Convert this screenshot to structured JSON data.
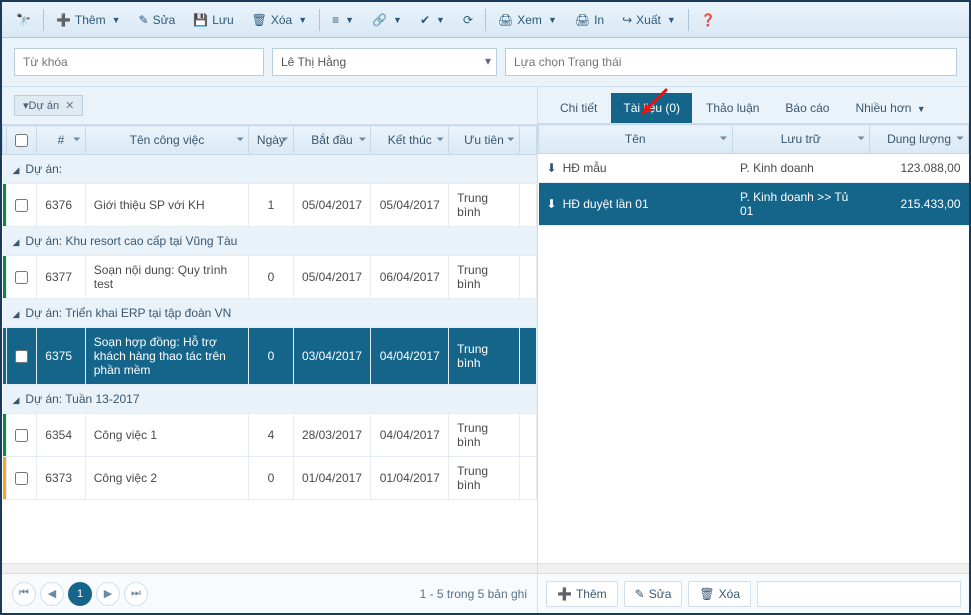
{
  "toolbar": {
    "add": "Thêm",
    "edit": "Sửa",
    "save": "Lưu",
    "delete": "Xóa",
    "view": "Xem",
    "print": "In",
    "export": "Xuất"
  },
  "filters": {
    "keyword_placeholder": "Từ khóa",
    "user_value": "Lê Thị Hằng",
    "status_placeholder": "Lựa chọn Trạng thái",
    "tag_label": "Dự án"
  },
  "grid": {
    "columns": {
      "id": "#",
      "name": "Tên công việc",
      "days": "Ngày",
      "start": "Bắt đầu",
      "end": "Kết thúc",
      "priority": "Ưu tiên"
    },
    "groups": [
      {
        "title": "Dự án:",
        "rows": [
          {
            "id": "6376",
            "name": "Giới thiệu SP với KH",
            "days": "1",
            "start": "05/04/2017",
            "end": "05/04/2017",
            "priority": "Trung bình",
            "border": "green"
          }
        ]
      },
      {
        "title": "Dự án: Khu resort cao cấp tại Vũng Tàu",
        "rows": [
          {
            "id": "6377",
            "name": "Soạn nội dung: Quy trình test",
            "days": "0",
            "start": "05/04/2017",
            "end": "06/04/2017",
            "priority": "Trung bình",
            "border": "green"
          }
        ]
      },
      {
        "title": "Dự án: Triển khai ERP tại tập đoàn VN",
        "rows": [
          {
            "id": "6375",
            "name": "Soạn hợp đồng: Hỗ trợ khách hàng thao tác trên phần mềm",
            "days": "0",
            "start": "03/04/2017",
            "end": "04/04/2017",
            "priority": "Trung bình",
            "border": "green",
            "selected": true
          }
        ]
      },
      {
        "title": "Dự án: Tuần 13-2017",
        "rows": [
          {
            "id": "6354",
            "name": "Công việc 1",
            "days": "4",
            "start": "28/03/2017",
            "end": "04/04/2017",
            "priority": "Trung bình",
            "border": "green"
          },
          {
            "id": "6373",
            "name": "Công việc 2",
            "days": "0",
            "start": "01/04/2017",
            "end": "01/04/2017",
            "priority": "Trung bình",
            "border": "orange"
          }
        ]
      }
    ]
  },
  "pager": {
    "current": "1",
    "info": "1 - 5 trong 5 bản ghi"
  },
  "tabs": {
    "detail": "Chi tiết",
    "files": "Tài liệu (0)",
    "discuss": "Thảo luận",
    "report": "Báo cáo",
    "more": "Nhiều hơn"
  },
  "rgrid": {
    "columns": {
      "name": "Tên",
      "storage": "Lưu trữ",
      "size": "Dung lượng"
    },
    "rows": [
      {
        "name": "HĐ mẫu",
        "storage": "P. Kinh doanh",
        "size": "123.088,00"
      },
      {
        "name": "HĐ duyệt lần 01",
        "storage": "P. Kinh doanh >> Tủ 01",
        "size": "215.433,00",
        "selected": true
      }
    ]
  },
  "rfoot": {
    "add": "Thêm",
    "edit": "Sửa",
    "delete": "Xóa"
  }
}
